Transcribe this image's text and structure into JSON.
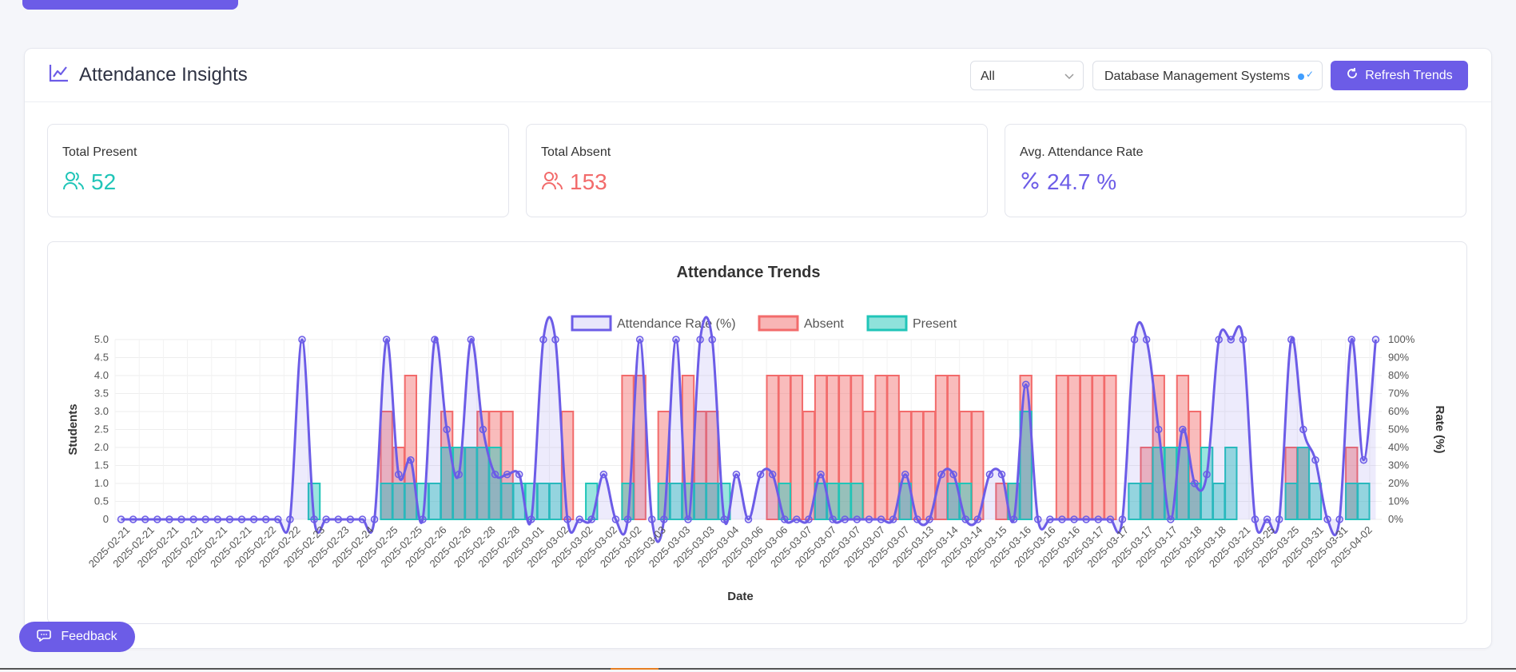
{
  "header": {
    "title": "Attendance Insights",
    "filter_value": "All",
    "course_value": "Database Management Systems",
    "refresh_label": "Refresh Trends"
  },
  "stats": {
    "present": {
      "label": "Total Present",
      "value": "52",
      "color": "#20c5b8"
    },
    "absent": {
      "label": "Total Absent",
      "value": "153",
      "color": "#f26b6b"
    },
    "rate": {
      "label": "Avg. Attendance Rate",
      "value": "24.7 %",
      "color": "#6c5ce7"
    }
  },
  "feedback_label": "Feedback",
  "colors": {
    "accent": "#6c5ce7",
    "present": "#20c5b8",
    "absent": "#f26b6b"
  },
  "icons": [
    "chart-line-icon",
    "chevron-down-icon",
    "refresh-icon",
    "users-icon",
    "percent-icon",
    "message-icon"
  ],
  "chart_data": {
    "type": "bar",
    "title": "Attendance Trends",
    "xlabel": "Date",
    "ylabel": "Students",
    "y2label": "Rate (%)",
    "ylim": [
      0,
      5
    ],
    "y2lim": [
      0,
      100
    ],
    "yticks": [
      "0",
      "0.5",
      "1.0",
      "1.5",
      "2.0",
      "2.5",
      "3.0",
      "3.5",
      "4.0",
      "4.5",
      "5.0"
    ],
    "y2ticks": [
      "0%",
      "10%",
      "20%",
      "30%",
      "40%",
      "50%",
      "60%",
      "70%",
      "80%",
      "90%",
      "100%"
    ],
    "legend": [
      "Attendance Rate (%)",
      "Absent",
      "Present"
    ],
    "legend_position": "top",
    "grid": true,
    "tick_labels": [
      "2025-02-21",
      "2025-02-21",
      "2025-02-21",
      "2025-02-21",
      "2025-02-21",
      "2025-02-21",
      "2025-02-22",
      "2025-02-22",
      "2025-02-23",
      "2025-02-23",
      "2025-02-24",
      "2025-02-25",
      "2025-02-25",
      "2025-02-26",
      "2025-02-26",
      "2025-02-28",
      "2025-02-28",
      "2025-03-01",
      "2025-03-02",
      "2025-03-02",
      "2025-03-02",
      "2025-03-02",
      "2025-03-03",
      "2025-03-03",
      "2025-03-03",
      "2025-03-04",
      "2025-03-06",
      "2025-03-06",
      "2025-03-07",
      "2025-03-07",
      "2025-03-07",
      "2025-03-07",
      "2025-03-07",
      "2025-03-13",
      "2025-03-14",
      "2025-03-14",
      "2025-03-15",
      "2025-03-16",
      "2025-03-16",
      "2025-03-16",
      "2025-03-17",
      "2025-03-17",
      "2025-03-17",
      "2025-03-17",
      "2025-03-18",
      "2025-03-18",
      "2025-03-21",
      "2025-03-25",
      "2025-03-25",
      "2025-03-31",
      "2025-03-31",
      "2025-04-02"
    ],
    "series": [
      {
        "name": "Absent",
        "values": [
          0,
          0,
          0,
          0,
          0,
          0,
          0,
          0,
          0,
          0,
          0,
          0,
          0,
          0,
          0,
          0,
          0,
          0,
          0,
          0,
          0,
          0,
          3,
          2,
          4,
          0,
          0,
          3,
          2,
          2,
          3,
          3,
          3,
          0,
          0,
          0,
          0,
          3,
          0,
          0,
          0,
          0,
          4,
          4,
          0,
          3,
          0,
          4,
          3,
          3,
          0,
          0,
          0,
          0,
          4,
          4,
          4,
          3,
          4,
          4,
          4,
          4,
          3,
          4,
          4,
          3,
          3,
          3,
          4,
          4,
          3,
          3,
          0,
          1,
          1,
          4,
          0,
          0,
          4,
          4,
          4,
          4,
          4,
          0,
          0,
          2,
          4,
          2,
          4,
          3,
          0,
          0,
          0,
          0,
          0,
          0,
          0,
          2,
          2,
          0,
          0,
          0,
          2,
          0
        ]
      },
      {
        "name": "Present",
        "values": [
          0,
          0,
          0,
          0,
          0,
          0,
          0,
          0,
          0,
          0,
          0,
          0,
          0,
          0,
          0,
          0,
          1,
          0,
          0,
          0,
          0,
          0,
          1,
          1,
          1,
          1,
          1,
          2,
          2,
          2,
          2,
          2,
          1,
          1,
          1,
          1,
          1,
          0,
          0,
          1,
          0,
          0,
          1,
          0,
          0,
          1,
          1,
          1,
          1,
          1,
          1,
          0,
          0,
          0,
          0,
          1,
          0,
          0,
          1,
          1,
          1,
          1,
          0,
          0,
          0,
          1,
          0,
          0,
          0,
          1,
          1,
          0,
          0,
          0,
          1,
          3,
          0,
          0,
          0,
          0,
          0,
          0,
          0,
          0,
          1,
          1,
          2,
          2,
          2,
          1,
          2,
          1,
          2,
          0,
          0,
          0,
          0,
          1,
          2,
          1,
          0,
          0,
          1,
          1
        ]
      },
      {
        "name": "Attendance Rate (%)",
        "values": [
          0,
          0,
          0,
          0,
          0,
          0,
          0,
          0,
          0,
          0,
          0,
          0,
          0,
          0,
          0,
          100,
          0,
          0,
          0,
          0,
          0,
          0,
          100,
          25,
          33,
          0,
          100,
          50,
          25,
          100,
          50,
          25,
          25,
          25,
          0,
          100,
          100,
          0,
          0,
          0,
          25,
          0,
          0,
          100,
          0,
          0,
          100,
          0,
          100,
          100,
          0,
          25,
          0,
          25,
          25,
          0,
          0,
          0,
          25,
          0,
          0,
          0,
          0,
          0,
          0,
          25,
          0,
          0,
          25,
          25,
          0,
          0,
          25,
          25,
          0,
          75,
          0,
          0,
          0,
          0,
          0,
          0,
          0,
          0,
          100,
          100,
          50,
          0,
          50,
          20,
          25,
          100,
          100,
          100,
          0,
          0,
          0,
          100,
          50,
          33,
          0,
          0,
          100,
          33,
          100
        ]
      }
    ]
  }
}
